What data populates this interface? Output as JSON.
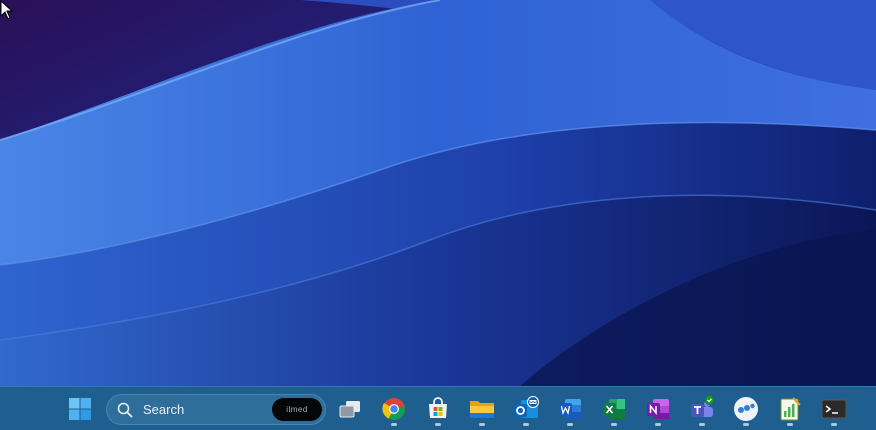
{
  "desktop": {
    "wallpaper_name": "windows-11-bloom-wallpaper",
    "colors": {
      "light": "#3f7be0",
      "mid": "#2547b8",
      "dark": "#0b1552",
      "deep": "#2a0f58"
    }
  },
  "taskbar": {
    "color": "#1f5f8f",
    "search": {
      "label": "Search",
      "badge_text": "ilmed"
    },
    "apps": [
      {
        "name": "task-view",
        "running": false
      },
      {
        "name": "chrome",
        "running": true
      },
      {
        "name": "microsoft-store",
        "running": true
      },
      {
        "name": "file-explorer",
        "running": true
      },
      {
        "name": "outlook",
        "running": true
      },
      {
        "name": "word",
        "running": true
      },
      {
        "name": "excel",
        "running": true
      },
      {
        "name": "onenote",
        "running": true
      },
      {
        "name": "teams",
        "running": true
      },
      {
        "name": "app-dots",
        "running": true
      },
      {
        "name": "notepad-chart",
        "running": true
      },
      {
        "name": "terminal",
        "running": true
      }
    ]
  }
}
